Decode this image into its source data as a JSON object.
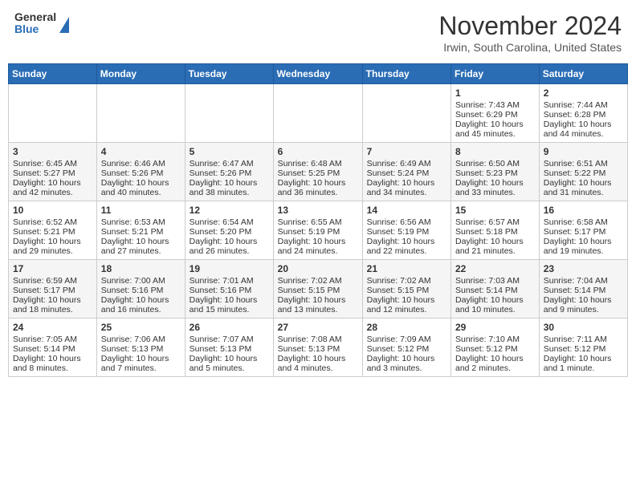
{
  "header": {
    "logo_line1": "General",
    "logo_line2": "Blue",
    "title": "November 2024",
    "subtitle": "Irwin, South Carolina, United States"
  },
  "weekdays": [
    "Sunday",
    "Monday",
    "Tuesday",
    "Wednesday",
    "Thursday",
    "Friday",
    "Saturday"
  ],
  "weeks": [
    [
      {
        "day": "",
        "sunrise": "",
        "sunset": "",
        "daylight": ""
      },
      {
        "day": "",
        "sunrise": "",
        "sunset": "",
        "daylight": ""
      },
      {
        "day": "",
        "sunrise": "",
        "sunset": "",
        "daylight": ""
      },
      {
        "day": "",
        "sunrise": "",
        "sunset": "",
        "daylight": ""
      },
      {
        "day": "",
        "sunrise": "",
        "sunset": "",
        "daylight": ""
      },
      {
        "day": "1",
        "sunrise": "Sunrise: 7:43 AM",
        "sunset": "Sunset: 6:29 PM",
        "daylight": "Daylight: 10 hours and 45 minutes."
      },
      {
        "day": "2",
        "sunrise": "Sunrise: 7:44 AM",
        "sunset": "Sunset: 6:28 PM",
        "daylight": "Daylight: 10 hours and 44 minutes."
      }
    ],
    [
      {
        "day": "3",
        "sunrise": "Sunrise: 6:45 AM",
        "sunset": "Sunset: 5:27 PM",
        "daylight": "Daylight: 10 hours and 42 minutes."
      },
      {
        "day": "4",
        "sunrise": "Sunrise: 6:46 AM",
        "sunset": "Sunset: 5:26 PM",
        "daylight": "Daylight: 10 hours and 40 minutes."
      },
      {
        "day": "5",
        "sunrise": "Sunrise: 6:47 AM",
        "sunset": "Sunset: 5:26 PM",
        "daylight": "Daylight: 10 hours and 38 minutes."
      },
      {
        "day": "6",
        "sunrise": "Sunrise: 6:48 AM",
        "sunset": "Sunset: 5:25 PM",
        "daylight": "Daylight: 10 hours and 36 minutes."
      },
      {
        "day": "7",
        "sunrise": "Sunrise: 6:49 AM",
        "sunset": "Sunset: 5:24 PM",
        "daylight": "Daylight: 10 hours and 34 minutes."
      },
      {
        "day": "8",
        "sunrise": "Sunrise: 6:50 AM",
        "sunset": "Sunset: 5:23 PM",
        "daylight": "Daylight: 10 hours and 33 minutes."
      },
      {
        "day": "9",
        "sunrise": "Sunrise: 6:51 AM",
        "sunset": "Sunset: 5:22 PM",
        "daylight": "Daylight: 10 hours and 31 minutes."
      }
    ],
    [
      {
        "day": "10",
        "sunrise": "Sunrise: 6:52 AM",
        "sunset": "Sunset: 5:21 PM",
        "daylight": "Daylight: 10 hours and 29 minutes."
      },
      {
        "day": "11",
        "sunrise": "Sunrise: 6:53 AM",
        "sunset": "Sunset: 5:21 PM",
        "daylight": "Daylight: 10 hours and 27 minutes."
      },
      {
        "day": "12",
        "sunrise": "Sunrise: 6:54 AM",
        "sunset": "Sunset: 5:20 PM",
        "daylight": "Daylight: 10 hours and 26 minutes."
      },
      {
        "day": "13",
        "sunrise": "Sunrise: 6:55 AM",
        "sunset": "Sunset: 5:19 PM",
        "daylight": "Daylight: 10 hours and 24 minutes."
      },
      {
        "day": "14",
        "sunrise": "Sunrise: 6:56 AM",
        "sunset": "Sunset: 5:19 PM",
        "daylight": "Daylight: 10 hours and 22 minutes."
      },
      {
        "day": "15",
        "sunrise": "Sunrise: 6:57 AM",
        "sunset": "Sunset: 5:18 PM",
        "daylight": "Daylight: 10 hours and 21 minutes."
      },
      {
        "day": "16",
        "sunrise": "Sunrise: 6:58 AM",
        "sunset": "Sunset: 5:17 PM",
        "daylight": "Daylight: 10 hours and 19 minutes."
      }
    ],
    [
      {
        "day": "17",
        "sunrise": "Sunrise: 6:59 AM",
        "sunset": "Sunset: 5:17 PM",
        "daylight": "Daylight: 10 hours and 18 minutes."
      },
      {
        "day": "18",
        "sunrise": "Sunrise: 7:00 AM",
        "sunset": "Sunset: 5:16 PM",
        "daylight": "Daylight: 10 hours and 16 minutes."
      },
      {
        "day": "19",
        "sunrise": "Sunrise: 7:01 AM",
        "sunset": "Sunset: 5:16 PM",
        "daylight": "Daylight: 10 hours and 15 minutes."
      },
      {
        "day": "20",
        "sunrise": "Sunrise: 7:02 AM",
        "sunset": "Sunset: 5:15 PM",
        "daylight": "Daylight: 10 hours and 13 minutes."
      },
      {
        "day": "21",
        "sunrise": "Sunrise: 7:02 AM",
        "sunset": "Sunset: 5:15 PM",
        "daylight": "Daylight: 10 hours and 12 minutes."
      },
      {
        "day": "22",
        "sunrise": "Sunrise: 7:03 AM",
        "sunset": "Sunset: 5:14 PM",
        "daylight": "Daylight: 10 hours and 10 minutes."
      },
      {
        "day": "23",
        "sunrise": "Sunrise: 7:04 AM",
        "sunset": "Sunset: 5:14 PM",
        "daylight": "Daylight: 10 hours and 9 minutes."
      }
    ],
    [
      {
        "day": "24",
        "sunrise": "Sunrise: 7:05 AM",
        "sunset": "Sunset: 5:14 PM",
        "daylight": "Daylight: 10 hours and 8 minutes."
      },
      {
        "day": "25",
        "sunrise": "Sunrise: 7:06 AM",
        "sunset": "Sunset: 5:13 PM",
        "daylight": "Daylight: 10 hours and 7 minutes."
      },
      {
        "day": "26",
        "sunrise": "Sunrise: 7:07 AM",
        "sunset": "Sunset: 5:13 PM",
        "daylight": "Daylight: 10 hours and 5 minutes."
      },
      {
        "day": "27",
        "sunrise": "Sunrise: 7:08 AM",
        "sunset": "Sunset: 5:13 PM",
        "daylight": "Daylight: 10 hours and 4 minutes."
      },
      {
        "day": "28",
        "sunrise": "Sunrise: 7:09 AM",
        "sunset": "Sunset: 5:12 PM",
        "daylight": "Daylight: 10 hours and 3 minutes."
      },
      {
        "day": "29",
        "sunrise": "Sunrise: 7:10 AM",
        "sunset": "Sunset: 5:12 PM",
        "daylight": "Daylight: 10 hours and 2 minutes."
      },
      {
        "day": "30",
        "sunrise": "Sunrise: 7:11 AM",
        "sunset": "Sunset: 5:12 PM",
        "daylight": "Daylight: 10 hours and 1 minute."
      }
    ]
  ]
}
